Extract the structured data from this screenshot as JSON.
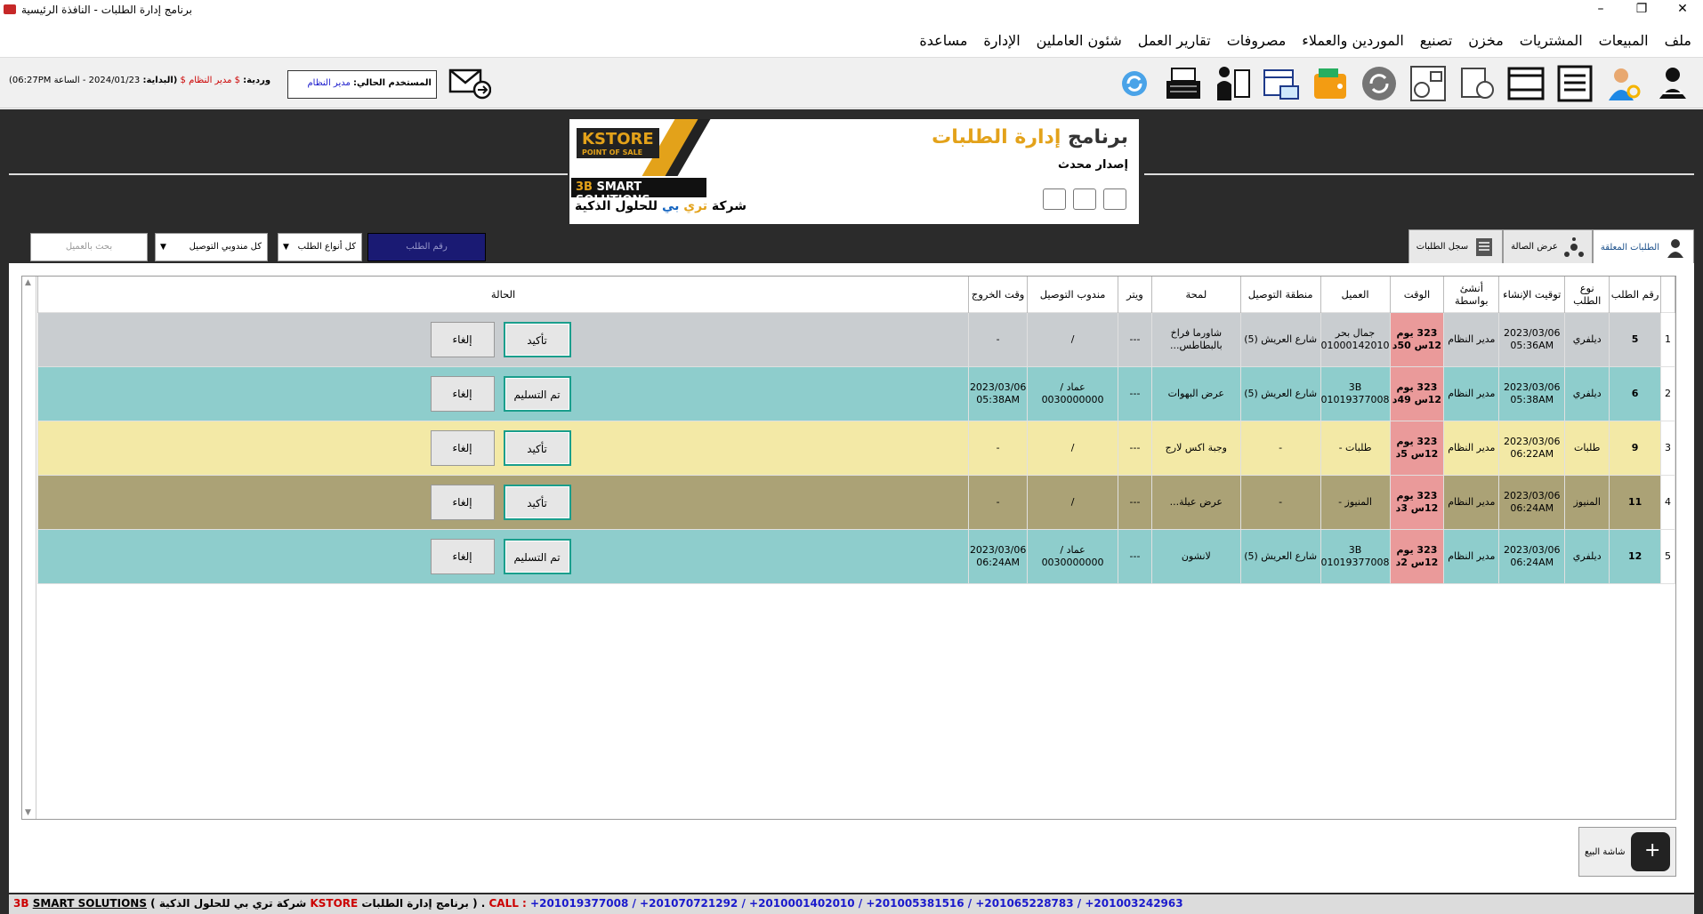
{
  "window": {
    "title": "برنامج إدارة الطلبات - النافذة الرئيسية",
    "controls": [
      "–",
      "❐",
      "✕"
    ]
  },
  "menu": [
    "ملف",
    "المبيعات",
    "المشتريات",
    "مخزن",
    "تصنيع",
    "الموردين والعملاء",
    "مصروفات",
    "تقارير العمل",
    "شئون العاملين",
    "الإدارة",
    "مساعدة"
  ],
  "toolbar": {
    "icons": [
      "user-switch-icon",
      "user-settings-icon",
      "checklist-icon",
      "window-icon",
      "gear-doc-icon",
      "dashboard-icon",
      "refresh-icon",
      "wallet-icon",
      "calendar-money-icon",
      "employee-docs-icon",
      "cash-register-icon",
      "sync-icon"
    ],
    "current_user_label": "المستخدم الحالي:",
    "current_user": "مدير النظام",
    "shift_label": "وردية:",
    "shift_user": "$ مدير النظام $",
    "start_label": "(البداية:",
    "start_value": "2024/01/23 - الساعة 06:27PM)"
  },
  "banner": {
    "title_prefix": "برنامج",
    "title_accent": "إدارة الطلبات",
    "subtitle": "إصدار محدث",
    "kstore": "KSTORE",
    "kstore_sub": "POINT OF SALE",
    "smart": "SMART SOLUTIONS",
    "smart_prefix": "3B",
    "company_1": "شركة",
    "company_2": "تري",
    "company_3": "بي",
    "company_4": "للحلول الذكية"
  },
  "filters": {
    "search_placeholder": "بحث بالعميل",
    "delivery_select": "كل مندوبي التوصيل",
    "type_select": "كل أنواع الطلب",
    "order_number_placeholder": "رقم الطلب"
  },
  "tabs": [
    {
      "label": "الطلبات المعلقة",
      "active": true
    },
    {
      "label": "عرض الصالة",
      "active": false
    },
    {
      "label": "سجل الطلبات",
      "active": false
    }
  ],
  "table": {
    "headers": [
      "",
      "رقم الطلب",
      "نوع الطلب",
      "توقيت الإنشاء",
      "أنشئ بواسطة",
      "الوقت",
      "العميل",
      "منطقة التوصيل",
      "لمحة",
      "ويتر",
      "مندوب التوصيل",
      "وقت الخروج",
      "الحالة"
    ],
    "rows": [
      {
        "idx": "1",
        "num": "5",
        "type": "ديلفري",
        "created": "2023/03/06 05:36AM",
        "by": "مدير النظام",
        "time": "323 يوم 12س 50د",
        "customer": "جمال بحر 01000142010",
        "zone": "شارع العريش (5)",
        "glance": "شاورما فراخ بالبطاطس...",
        "waiter": "---",
        "delivery": "/",
        "out": "-",
        "action": "تأكيد",
        "cancel": "إلغاء",
        "bg": "#c9cdd0"
      },
      {
        "idx": "2",
        "num": "6",
        "type": "ديلفري",
        "created": "2023/03/06 05:38AM",
        "by": "مدير النظام",
        "time": "323 يوم 12س 49د",
        "customer": "3B 01019377008",
        "zone": "شارع العريش (5)",
        "glance": "عرض البهوات",
        "waiter": "---",
        "delivery": "عماد / 0030000000",
        "out": "2023/03/06 05:38AM",
        "action": "تم التسليم",
        "cancel": "إلغاء",
        "bg": "#8ecdcc"
      },
      {
        "idx": "3",
        "num": "9",
        "type": "طلبات",
        "created": "2023/03/06 06:22AM",
        "by": "مدير النظام",
        "time": "323 يوم 12س 5د",
        "customer": "طلبات -",
        "zone": "-",
        "glance": "وجبة اكس لارج",
        "waiter": "---",
        "delivery": "/",
        "out": "-",
        "action": "تأكيد",
        "cancel": "إلغاء",
        "bg": "#f3e9a6"
      },
      {
        "idx": "4",
        "num": "11",
        "type": "المنيوز",
        "created": "2023/03/06 06:24AM",
        "by": "مدير النظام",
        "time": "323 يوم 12س 3د",
        "customer": "المنيوز -",
        "zone": "-",
        "glance": "عرض عيلة...",
        "waiter": "---",
        "delivery": "/",
        "out": "-",
        "action": "تأكيد",
        "cancel": "إلغاء",
        "bg": "#aba276"
      },
      {
        "idx": "5",
        "num": "12",
        "type": "ديلفري",
        "created": "2023/03/06 06:24AM",
        "by": "مدير النظام",
        "time": "323 يوم 12س 2د",
        "customer": "3B 01019377008",
        "zone": "شارع العريش (5)",
        "glance": "لانشون",
        "waiter": "---",
        "delivery": "عماد / 0030000000",
        "out": "2023/03/06 06:24AM",
        "action": "تم التسليم",
        "cancel": "إلغاء",
        "bg": "#8ecdcc"
      }
    ]
  },
  "new_sale_label": "شاشة البيع",
  "footer": {
    "prefix": "3B",
    "brand": "SMART SOLUTIONS",
    "company": "( شركة تري بي للحلول الذكية",
    "kstore": "KSTORE",
    "program": "برنامج إدارة الطلبات ) .",
    "call": "CALL :",
    "phones": "+201019377008 / +201070721292 / +2010001402010 / +201005381516 / +201065228783 / +201003242963"
  }
}
